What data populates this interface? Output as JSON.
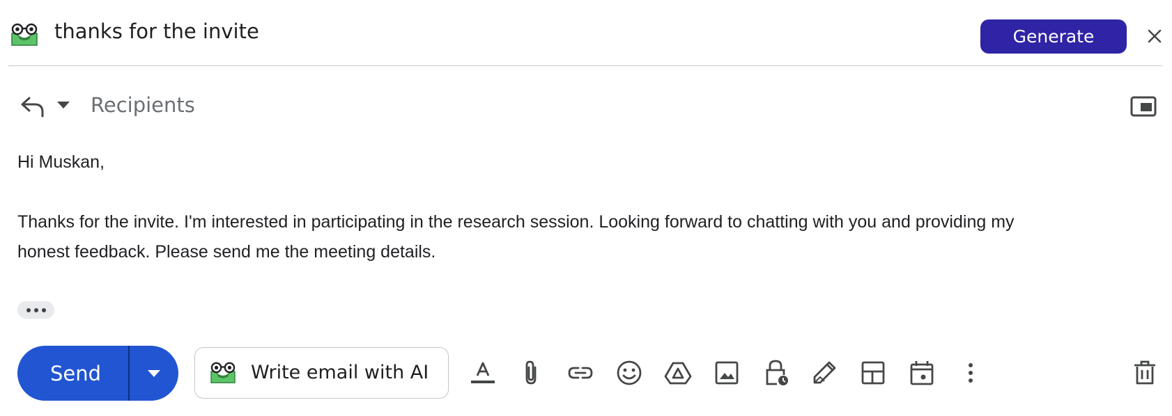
{
  "ai_bar": {
    "logo_icon": "ai-helper-logo-icon",
    "prompt": "thanks for the invite",
    "generate_label": "Generate",
    "close_icon": "close-icon",
    "accent_color": "#2f23a6"
  },
  "compose": {
    "reply_icon": "reply-icon",
    "reply_menu_icon": "chevron-down-icon",
    "recipients_placeholder": "Recipients",
    "popout_icon": "popout-icon",
    "body": {
      "greeting": "Hi Muskan,",
      "line1": "Thanks for the invite. I'm interested in participating in the research session. Looking forward to chatting with you and providing my",
      "line2": "honest feedback. Please send me the meeting details."
    },
    "trimmed_content_icon": "more-horizontal-icon"
  },
  "toolbar": {
    "send_label": "Send",
    "send_color": "#2155d1",
    "send_options_icon": "chevron-down-icon",
    "write_ai_label": "Write email with AI",
    "tools": [
      "text-format-icon",
      "attach-icon",
      "link-icon",
      "emoji-icon",
      "drive-icon",
      "image-icon",
      "confidential-mode-icon",
      "signature-icon",
      "template-icon",
      "schedule-icon",
      "more-options-icon"
    ],
    "discard_icon": "trash-icon"
  }
}
